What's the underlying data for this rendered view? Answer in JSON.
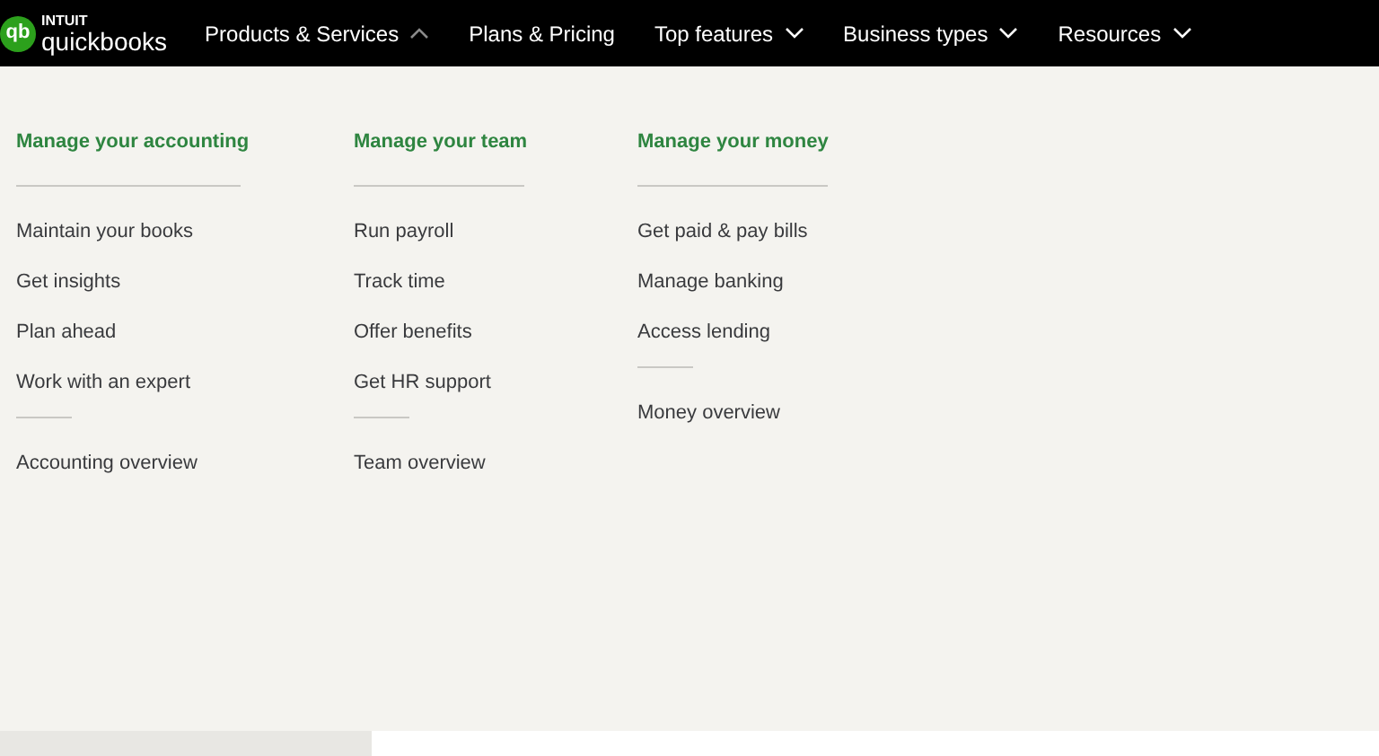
{
  "logo": {
    "mark": "qb",
    "brand": "INTUIT",
    "product": "quickbooks"
  },
  "nav": [
    {
      "label": "Products & Services",
      "expanded": true
    },
    {
      "label": "Plans & Pricing"
    },
    {
      "label": "Top features",
      "expanded": false
    },
    {
      "label": "Business types",
      "expanded": false
    },
    {
      "label": "Resources",
      "expanded": false
    }
  ],
  "menu_columns": [
    {
      "heading": "Manage your accounting",
      "items": [
        "Maintain your books",
        "Get insights",
        "Plan ahead",
        "Work with an expert"
      ],
      "overview": "Accounting overview"
    },
    {
      "heading": "Manage your team",
      "items": [
        "Run payroll",
        "Track time",
        "Offer benefits",
        "Get HR support"
      ],
      "overview": "Team overview"
    },
    {
      "heading": "Manage your money",
      "items": [
        "Get paid & pay bills",
        "Manage banking",
        "Access lending"
      ],
      "overview": "Money overview"
    }
  ]
}
